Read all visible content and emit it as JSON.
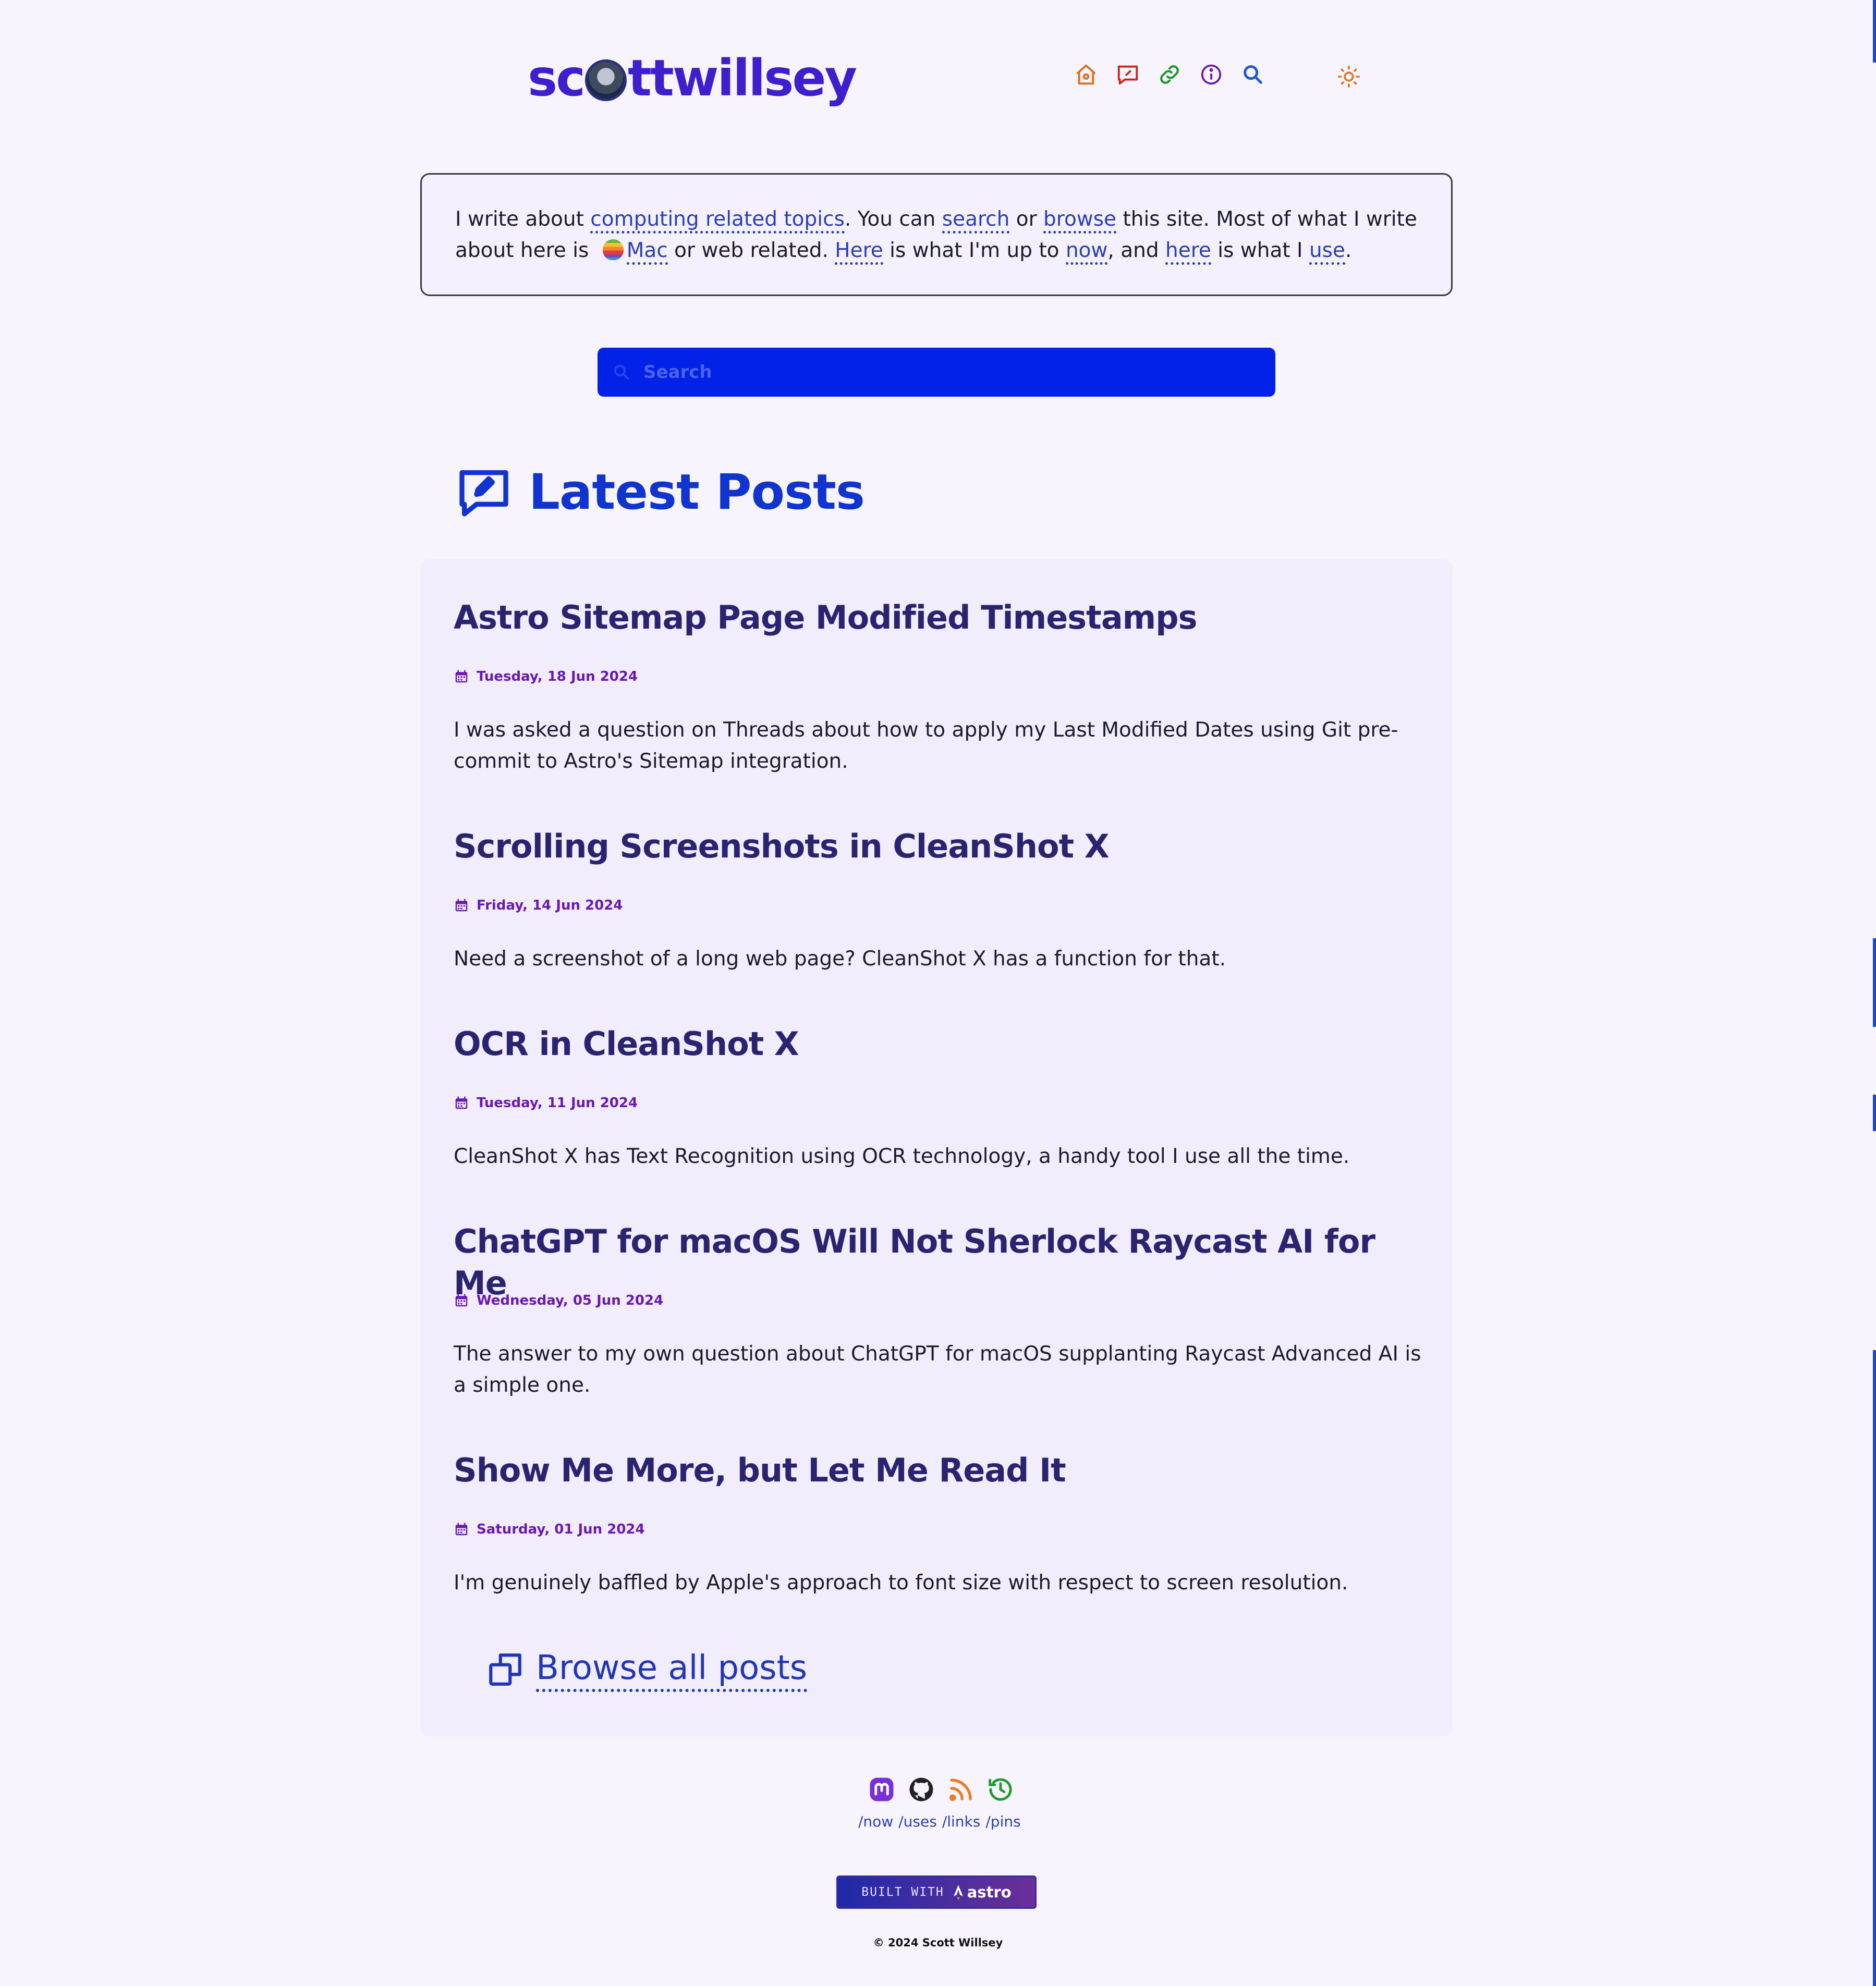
{
  "header": {
    "logo_left": "sc",
    "logo_right": "ttwillsey",
    "nav": [
      "home-icon",
      "posts-icon",
      "links-icon",
      "info-icon",
      "search-icon"
    ],
    "theme_icon": "sun-icon"
  },
  "intro": {
    "t1": "I write about ",
    "l1": "computing related topics",
    "t2": ". You can ",
    "l2": "search",
    "t3": " or ",
    "l3": "browse",
    "t4": " this site. Most of what I write about here is ",
    "l4": "Mac",
    "t5": " or web related. ",
    "l5": "Here",
    "t6": " is what I'm up to ",
    "l6": "now",
    "t7": ", and ",
    "l7": "here",
    "t8": " is what I ",
    "l8": "use",
    "t9": "."
  },
  "search": {
    "placeholder": "Search"
  },
  "latest": {
    "heading": "Latest Posts"
  },
  "posts": [
    {
      "title": "Astro Sitemap Page Modified Timestamps",
      "date": "Tuesday, 18 Jun 2024",
      "excerpt": "I was asked a question on Threads about how to apply my Last Modified Dates using Git pre-commit to Astro's Sitemap integration."
    },
    {
      "title": "Scrolling Screenshots in CleanShot X",
      "date": "Friday, 14 Jun 2024",
      "excerpt": "Need a screenshot of a long web page? CleanShot X has a function for that."
    },
    {
      "title": "OCR in CleanShot X",
      "date": "Tuesday, 11 Jun 2024",
      "excerpt": "CleanShot X has Text Recognition using OCR technology, a handy tool I use all the time."
    },
    {
      "title": "ChatGPT for macOS Will Not Sherlock Raycast AI for Me",
      "date": "Wednesday, 05 Jun 2024",
      "excerpt": "The answer to my own question about ChatGPT for macOS supplanting Raycast Advanced AI is a simple one."
    },
    {
      "title": "Show Me More, but Let Me Read It",
      "date": "Saturday, 01 Jun 2024",
      "excerpt": "I'm genuinely baffled by Apple's approach to font size with respect to screen resolution."
    }
  ],
  "browse": {
    "label": "Browse all posts"
  },
  "footer": {
    "socials": [
      "mastodon-icon",
      "github-icon",
      "rss-icon",
      "history-icon"
    ],
    "links": [
      "/now",
      "/uses",
      "/links",
      "/pins"
    ],
    "built_with": "BUILT WITH",
    "astro": "astro",
    "copyright": "© 2024 Scott Willsey"
  },
  "colors": {
    "background": "#f8f4fd",
    "accent": "#0222e8",
    "heading": "#1034cf",
    "post_title": "#2a2470",
    "date": "#6a17b4"
  }
}
